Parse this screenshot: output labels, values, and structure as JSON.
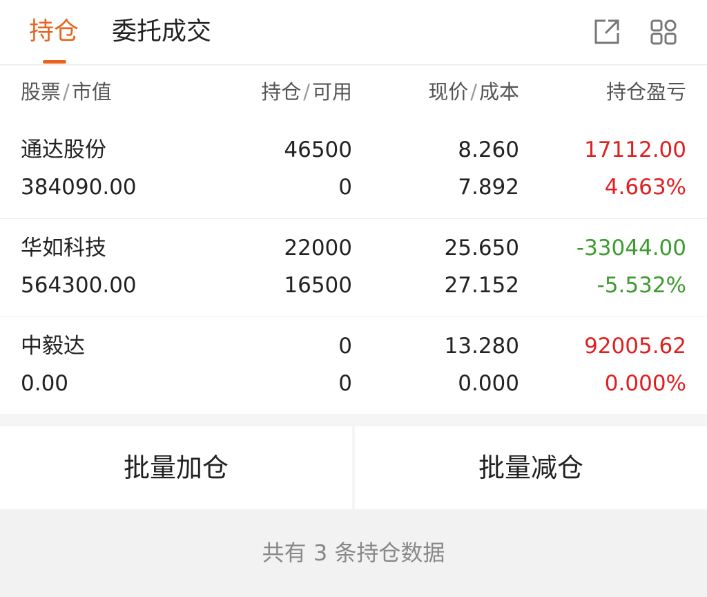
{
  "tabs": [
    {
      "label": "持仓",
      "active": true
    },
    {
      "label": "委托成交",
      "active": false
    }
  ],
  "icons": {
    "export": "external-link-icon",
    "grid": "grid-icon"
  },
  "colors": {
    "accent": "#e8641e",
    "up": "#e02020",
    "down": "#3c9b2e"
  },
  "table": {
    "headers": {
      "stock": "股票",
      "market_value": "市值",
      "position": "持仓",
      "available": "可用",
      "price": "现价",
      "cost": "成本",
      "pnl": "持仓盈亏"
    },
    "rows": [
      {
        "name": "通达股份",
        "market_value": "384090.00",
        "position": "46500",
        "available": "0",
        "price": "8.260",
        "cost": "7.892",
        "pnl": "17112.00",
        "pnl_pct": "4.663%",
        "trend": "up"
      },
      {
        "name": "华如科技",
        "market_value": "564300.00",
        "position": "22000",
        "available": "16500",
        "price": "25.650",
        "cost": "27.152",
        "pnl": "-33044.00",
        "pnl_pct": "-5.532%",
        "trend": "down"
      },
      {
        "name": "中毅达",
        "market_value": "0.00",
        "position": "0",
        "available": "0",
        "price": "13.280",
        "cost": "0.000",
        "pnl": "92005.62",
        "pnl_pct": "0.000%",
        "trend": "up"
      }
    ]
  },
  "actions": {
    "batch_add": "批量加仓",
    "batch_reduce": "批量减仓"
  },
  "footer": {
    "summary": "共有 3 条持仓数据"
  }
}
